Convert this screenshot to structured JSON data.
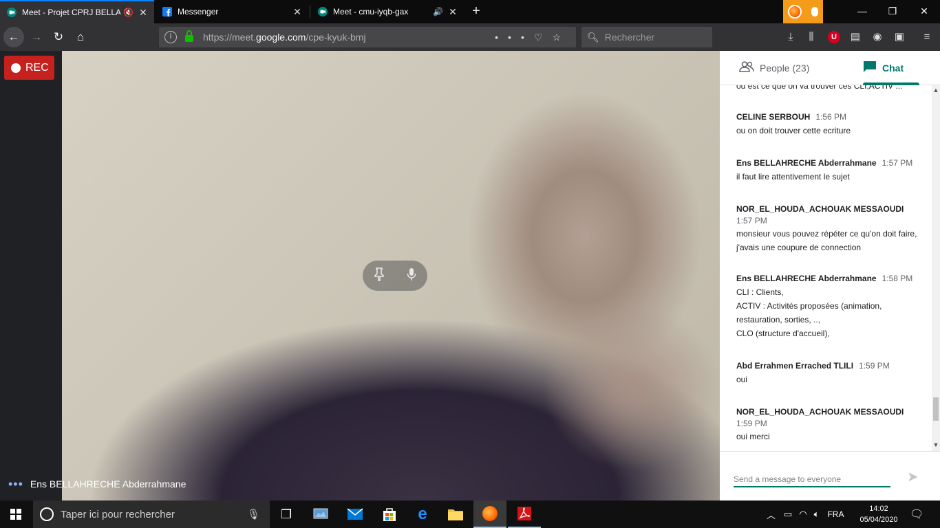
{
  "browser": {
    "tabs": [
      {
        "label": "Meet - Projet CPRJ BELLAHREC",
        "extra": "🔇",
        "active": true
      },
      {
        "label": "Messenger",
        "extra": "",
        "active": false
      },
      {
        "label": "Meet - cmu-iyqb-gax",
        "extra": "🔊",
        "active": false
      }
    ],
    "url_prefix": "https://meet.",
    "url_domain": "google.com",
    "url_path": "/cpe-kyuk-bmj",
    "search_placeholder": "Rechercher"
  },
  "meet": {
    "rec_label": "REC",
    "speaker_name": "Ens BELLAHRECHE Abderrahmane"
  },
  "panel": {
    "people_tab": "People (23)",
    "chat_tab": "Chat",
    "cut_message": "ou est ce que on va trouver ces CLI,ACTIV ...",
    "messages": [
      {
        "sender": "CELINE SERBOUH",
        "time": "1:56 PM",
        "lines": [
          "ou on doit trouver cette ecriture"
        ]
      },
      {
        "sender": "Ens BELLAHRECHE Abderrahmane",
        "time": "1:57 PM",
        "lines": [
          "il faut lire attentivement le sujet"
        ]
      },
      {
        "sender": "NOR_EL_HOUDA_ACHOUAK MESSAOUDI",
        "time": "1:57 PM",
        "lines": [
          " monsieur vous pouvez répéter ce qu'on doit faire, j'avais une coupure de connection"
        ]
      },
      {
        "sender": "Ens BELLAHRECHE Abderrahmane",
        "time": "1:58 PM",
        "lines": [
          "CLI : Clients,",
          "ACTIV : Activités proposées (animation, restauration, sorties, ..,",
          "CLO (structure d'accueil),"
        ]
      },
      {
        "sender": "Abd Errahmen Errached TLILI",
        "time": "1:59 PM",
        "lines": [
          "oui"
        ]
      },
      {
        "sender": "NOR_EL_HOUDA_ACHOUAK MESSAOUDI",
        "time": "1:59 PM",
        "lines": [
          "oui merci"
        ]
      }
    ],
    "composer_placeholder": "Send a message to everyone"
  },
  "taskbar": {
    "search_placeholder": "Taper ici pour rechercher",
    "language": "FRA",
    "time": "14:02",
    "date": "05/04/2020"
  },
  "colors": {
    "accent": "#00796b",
    "rec": "#c5221f",
    "tab_highlight": "#0a84ff"
  }
}
